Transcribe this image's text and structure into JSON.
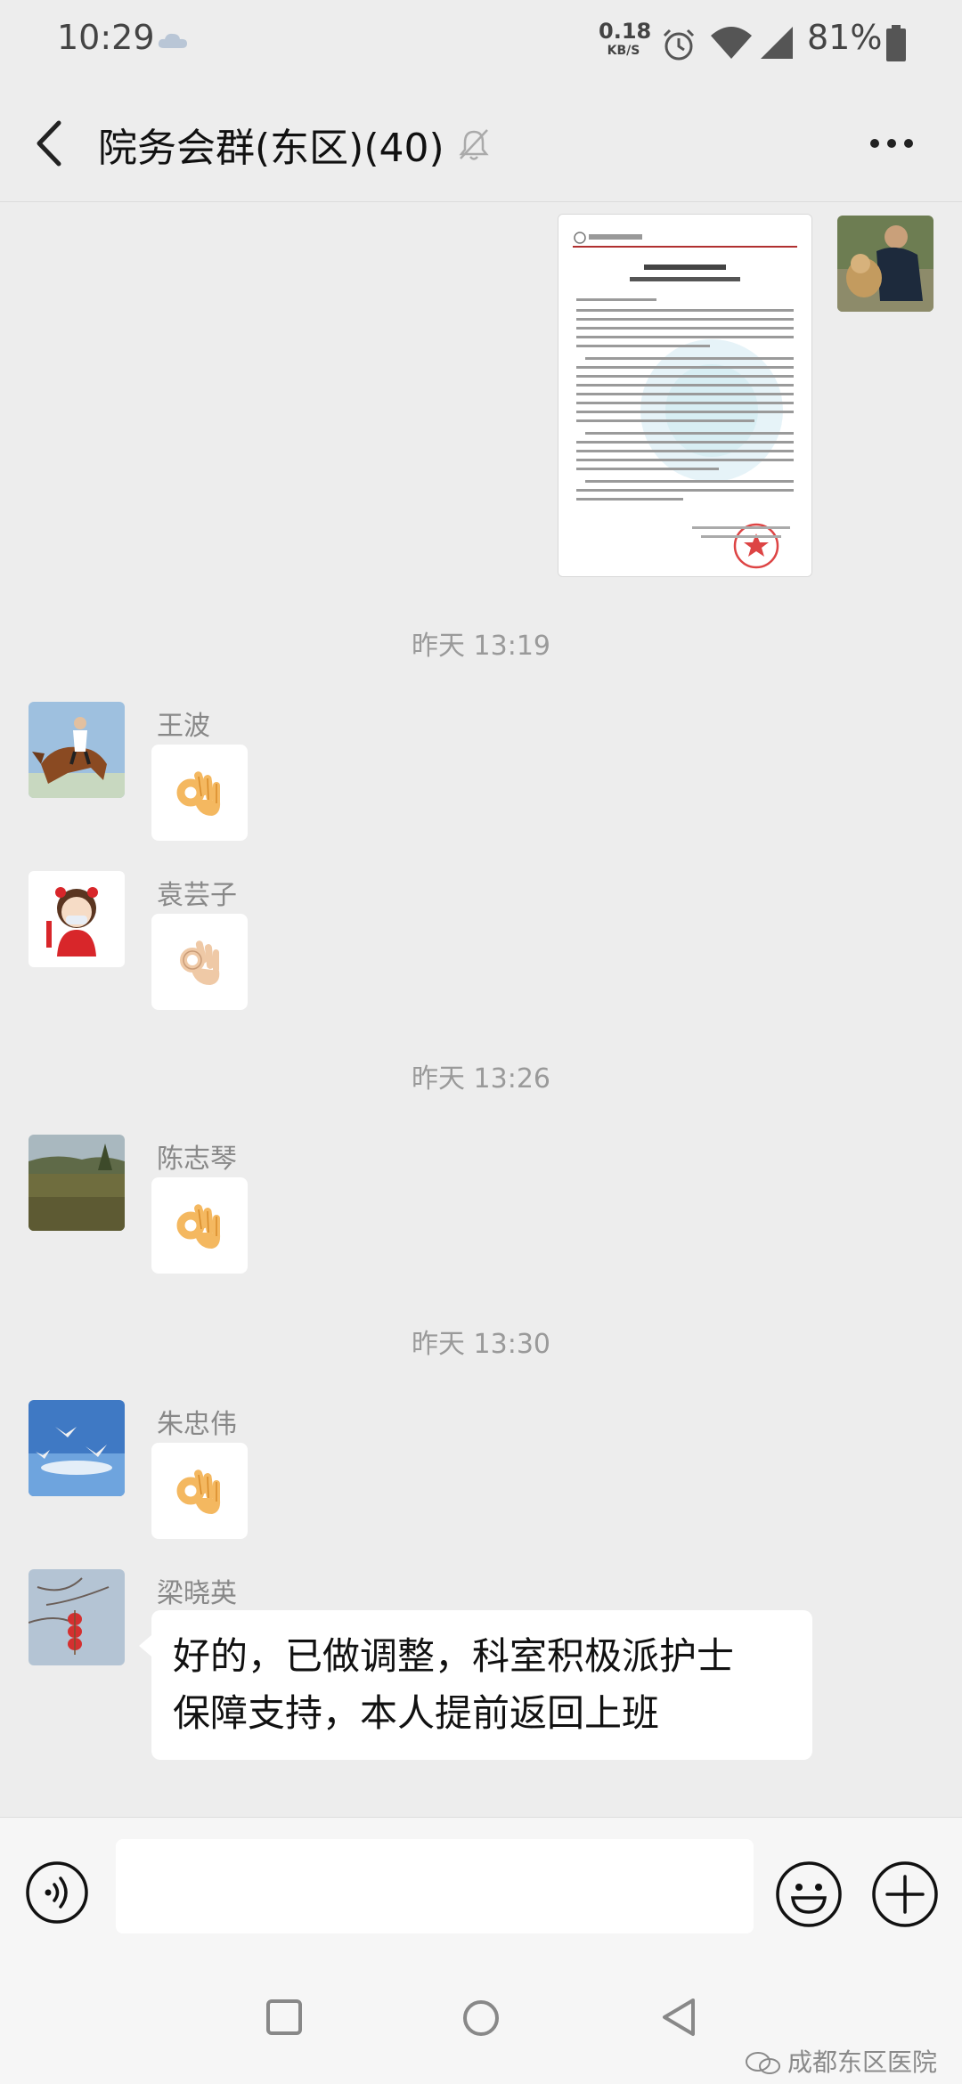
{
  "status_bar": {
    "time": "10:29",
    "net_speed_value": "0.18",
    "net_speed_unit": "KB/S",
    "battery": "81%"
  },
  "header": {
    "title": "院务会群(东区)(40)",
    "back_icon": "chevron-left-icon",
    "mute_icon": "bell-off-icon",
    "more_icon": "more-dots-icon"
  },
  "messages": {
    "ts1": "昨天 13:19",
    "ts2": "昨天 13:26",
    "ts3": "昨天 13:30",
    "items": [
      {
        "sender": "王波",
        "type": "emoji",
        "emoji": "ok-hand"
      },
      {
        "sender": "袁芸子",
        "type": "emoji",
        "emoji": "ok-hand-light"
      },
      {
        "sender": "陈志琴",
        "type": "emoji",
        "emoji": "ok-hand"
      },
      {
        "sender": "朱忠伟",
        "type": "emoji",
        "emoji": "ok-hand"
      },
      {
        "sender": "梁晓英",
        "type": "text",
        "text_line1": "好的，已做调整，科室积极派护士",
        "text_line2": "保障支持，本人提前返回上班"
      }
    ]
  },
  "input_bar": {
    "voice_icon": "voice-icon",
    "emoji_icon": "smiley-icon",
    "plus_icon": "plus-circle-icon"
  },
  "watermark": "成都东区医院",
  "colors": {
    "background": "#ededed",
    "bubble": "#ffffff",
    "emoji_skin": "#f4b860",
    "emoji_skin_light": "#efc9a6"
  }
}
